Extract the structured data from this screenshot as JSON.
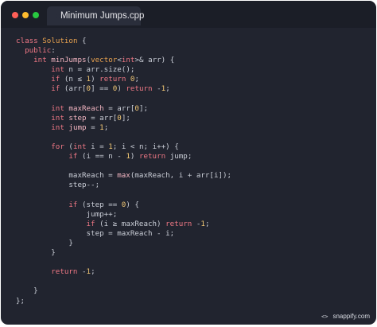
{
  "window": {
    "tab_title": "Minimum Jumps.cpp",
    "tab_icon": "cpp-file-icon"
  },
  "code": {
    "language": "cpp",
    "lines": [
      [
        [
          "kw",
          "class"
        ],
        [
          "p",
          " "
        ],
        [
          "ty",
          "Solution"
        ],
        [
          "p",
          " {"
        ]
      ],
      [
        [
          "p",
          "  "
        ],
        [
          "kw",
          "public"
        ],
        [
          "p",
          ":"
        ]
      ],
      [
        [
          "p",
          "    "
        ],
        [
          "kw",
          "int"
        ],
        [
          "p",
          " "
        ],
        [
          "fn",
          "minJumps"
        ],
        [
          "p",
          "("
        ],
        [
          "ty",
          "vector"
        ],
        [
          "p",
          "<"
        ],
        [
          "kw",
          "int"
        ],
        [
          "p",
          ">& arr) {"
        ]
      ],
      [
        [
          "p",
          "        "
        ],
        [
          "kw",
          "int"
        ],
        [
          "p",
          " n = arr.size();"
        ]
      ],
      [
        [
          "p",
          "        "
        ],
        [
          "kw",
          "if"
        ],
        [
          "p",
          " (n ≤ "
        ],
        [
          "num",
          "1"
        ],
        [
          "p",
          ") "
        ],
        [
          "kw",
          "return"
        ],
        [
          "p",
          " "
        ],
        [
          "num",
          "0"
        ],
        [
          "p",
          ";"
        ]
      ],
      [
        [
          "p",
          "        "
        ],
        [
          "kw",
          "if"
        ],
        [
          "p",
          " (arr["
        ],
        [
          "num",
          "0"
        ],
        [
          "p",
          "] == "
        ],
        [
          "num",
          "0"
        ],
        [
          "p",
          ") "
        ],
        [
          "kw",
          "return"
        ],
        [
          "p",
          " -"
        ],
        [
          "num",
          "1"
        ],
        [
          "p",
          ";"
        ]
      ],
      [
        [
          "p",
          ""
        ]
      ],
      [
        [
          "p",
          "        "
        ],
        [
          "kw",
          "int"
        ],
        [
          "p",
          " "
        ],
        [
          "var",
          "maxReach"
        ],
        [
          "p",
          " = arr["
        ],
        [
          "num",
          "0"
        ],
        [
          "p",
          "];"
        ]
      ],
      [
        [
          "p",
          "        "
        ],
        [
          "kw",
          "int"
        ],
        [
          "p",
          " "
        ],
        [
          "var",
          "step"
        ],
        [
          "p",
          " = arr["
        ],
        [
          "num",
          "0"
        ],
        [
          "p",
          "];"
        ]
      ],
      [
        [
          "p",
          "        "
        ],
        [
          "kw",
          "int"
        ],
        [
          "p",
          " "
        ],
        [
          "var",
          "jump"
        ],
        [
          "p",
          " = "
        ],
        [
          "num",
          "1"
        ],
        [
          "p",
          ";"
        ]
      ],
      [
        [
          "p",
          ""
        ]
      ],
      [
        [
          "p",
          "        "
        ],
        [
          "kw",
          "for"
        ],
        [
          "p",
          " ("
        ],
        [
          "kw",
          "int"
        ],
        [
          "p",
          " i = "
        ],
        [
          "num",
          "1"
        ],
        [
          "p",
          "; i < n; i++) {"
        ]
      ],
      [
        [
          "p",
          "            "
        ],
        [
          "kw",
          "if"
        ],
        [
          "p",
          " (i == n - "
        ],
        [
          "num",
          "1"
        ],
        [
          "p",
          ") "
        ],
        [
          "kw",
          "return"
        ],
        [
          "p",
          " jump;"
        ]
      ],
      [
        [
          "p",
          ""
        ]
      ],
      [
        [
          "p",
          "            maxReach = "
        ],
        [
          "fn",
          "max"
        ],
        [
          "p",
          "(maxReach, i + arr[i]);"
        ]
      ],
      [
        [
          "p",
          "            step--;"
        ]
      ],
      [
        [
          "p",
          ""
        ]
      ],
      [
        [
          "p",
          "            "
        ],
        [
          "kw",
          "if"
        ],
        [
          "p",
          " (step == "
        ],
        [
          "num",
          "0"
        ],
        [
          "p",
          ") {"
        ]
      ],
      [
        [
          "p",
          "                jump++;"
        ]
      ],
      [
        [
          "p",
          "                "
        ],
        [
          "kw",
          "if"
        ],
        [
          "p",
          " (i ≥ maxReach) "
        ],
        [
          "kw",
          "return"
        ],
        [
          "p",
          " -"
        ],
        [
          "num",
          "1"
        ],
        [
          "p",
          ";"
        ]
      ],
      [
        [
          "p",
          "                step = maxReach - i;"
        ]
      ],
      [
        [
          "p",
          "            }"
        ]
      ],
      [
        [
          "p",
          "        }"
        ]
      ],
      [
        [
          "p",
          ""
        ]
      ],
      [
        [
          "p",
          "        "
        ],
        [
          "kw",
          "return"
        ],
        [
          "p",
          " -"
        ],
        [
          "num",
          "1"
        ],
        [
          "p",
          ";"
        ]
      ],
      [
        [
          "p",
          ""
        ]
      ],
      [
        [
          "p",
          "    }"
        ]
      ],
      [
        [
          "p",
          "};"
        ]
      ]
    ]
  },
  "watermark": {
    "icon": "code-brackets-icon",
    "icon_glyph": "<>",
    "text": "snappify.com"
  }
}
